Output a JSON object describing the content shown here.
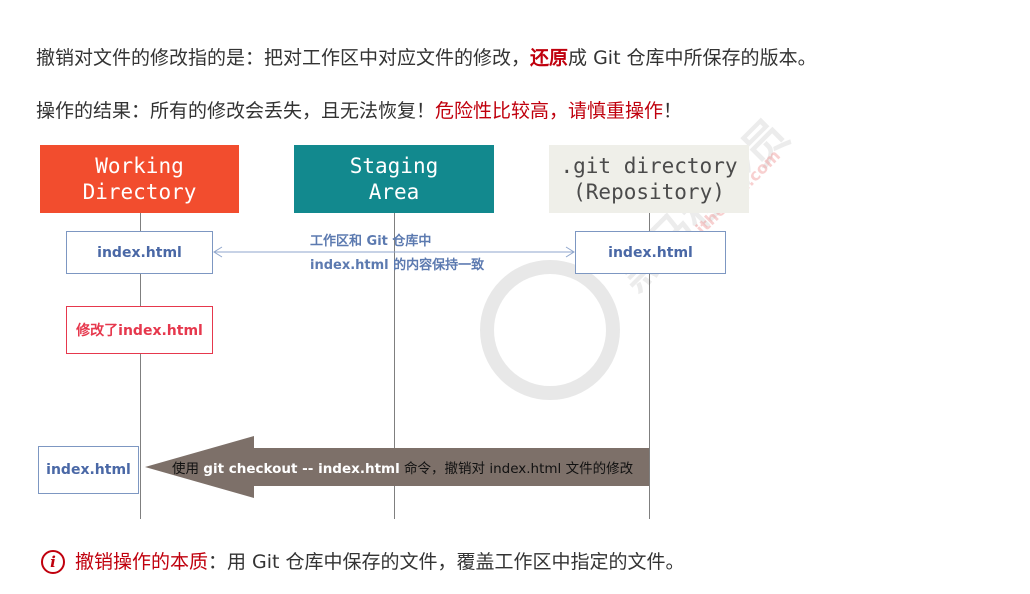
{
  "text": {
    "line1_pre": "撤销对文件的修改指的是：把对工作区中对应文件的修改，",
    "line1_em": "还原",
    "line1_post": "成 Git 仓库中所保存的版本。",
    "line2_pre": "操作的结果：所有的修改会丢失，且无法恢复！",
    "line2_red": "危险性比较高，请慎重操作",
    "line2_post": "！"
  },
  "diagram": {
    "headers": {
      "working": [
        "Working",
        "Directory"
      ],
      "staging": [
        "Staging",
        "Area"
      ],
      "repo": [
        ".git directory",
        "(Repository)"
      ]
    },
    "boxes": {
      "work_file": "index.html",
      "repo_file": "index.html",
      "modified": "修改了index.html",
      "restored_file": "index.html"
    },
    "sync_label": [
      "工作区和 Git 仓库中",
      "index.html 的内容保持一致"
    ],
    "arrow_label": {
      "pre": "使用 ",
      "cmd": "git checkout -- index.html",
      "post": " 命令，撤销对 index.html 文件的修改"
    }
  },
  "bottom": {
    "icon": "i",
    "red": "撤销操作的本质",
    "rest": "：用 Git 仓库中保存的文件，覆盖工作区中指定的文件。"
  },
  "watermark": {
    "brand": "黑马程序员",
    "url": "www.itheima.com"
  },
  "colors": {
    "working": "#f24d2e",
    "staging": "#12898e",
    "repo": "#efefe9",
    "accent_red": "#c0000d",
    "arrow": "#7d7069"
  }
}
